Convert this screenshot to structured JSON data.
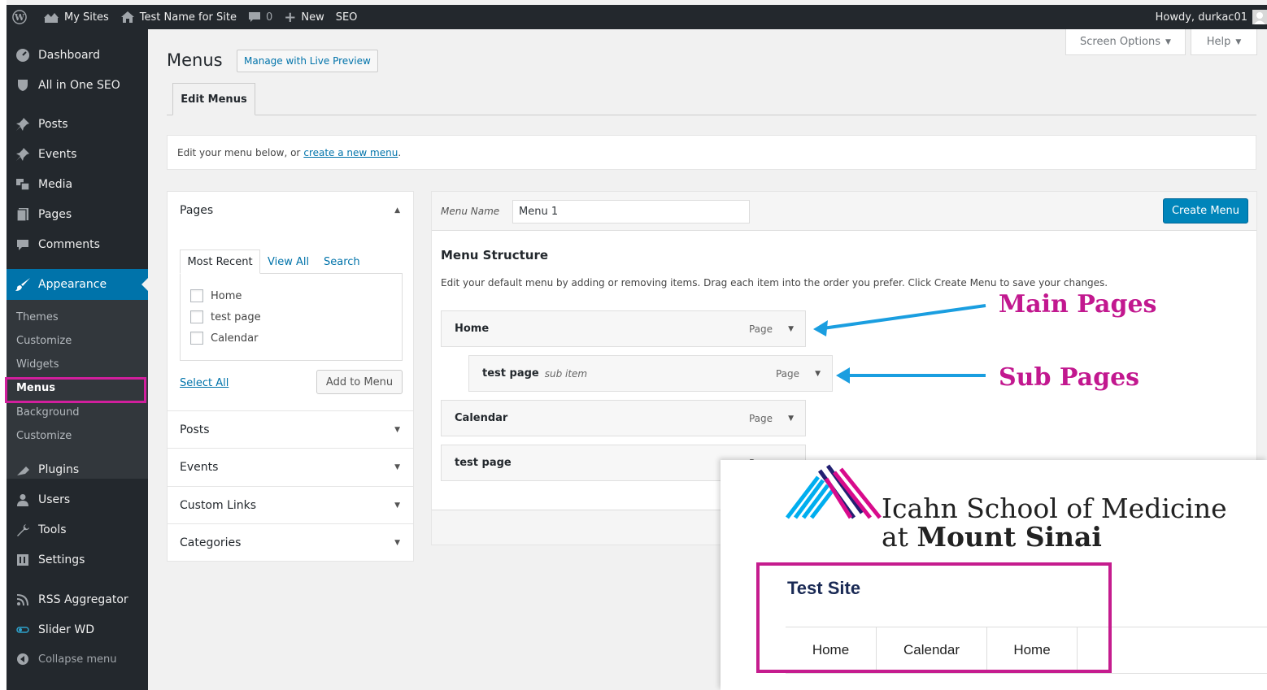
{
  "admin_bar": {
    "my_sites": "My Sites",
    "site_name": "Test Name for Site",
    "comments_count": "0",
    "new_label": "New",
    "seo_label": "SEO",
    "greeting": "Howdy, durkac01"
  },
  "sidebar": {
    "items": [
      {
        "label": "Dashboard",
        "icon": "dashboard-icon"
      },
      {
        "label": "All in One SEO",
        "icon": "shield-icon"
      },
      {
        "label": "Posts",
        "icon": "pin-icon"
      },
      {
        "label": "Events",
        "icon": "pin-icon"
      },
      {
        "label": "Media",
        "icon": "media-icon"
      },
      {
        "label": "Pages",
        "icon": "pages-icon"
      },
      {
        "label": "Comments",
        "icon": "comment-icon"
      },
      {
        "label": "Appearance",
        "icon": "paintbrush-icon"
      },
      {
        "label": "Plugins",
        "icon": "plug-icon"
      },
      {
        "label": "Users",
        "icon": "user-icon"
      },
      {
        "label": "Tools",
        "icon": "wrench-icon"
      },
      {
        "label": "Settings",
        "icon": "settings-icon"
      },
      {
        "label": "RSS Aggregator",
        "icon": "rss-icon"
      },
      {
        "label": "Slider WD",
        "icon": "slider-icon"
      },
      {
        "label": "Collapse menu",
        "icon": "collapse-icon"
      }
    ],
    "submenu": [
      "Themes",
      "Customize",
      "Widgets",
      "Menus",
      "Background",
      "Customize"
    ]
  },
  "header": {
    "title": "Menus",
    "live_preview": "Manage with Live Preview",
    "screen_options": "Screen Options",
    "help": "Help"
  },
  "tabs": {
    "edit_menus": "Edit Menus"
  },
  "notice": {
    "text": "Edit your menu below, or",
    "link": "create a new menu",
    "suffix": "."
  },
  "pages_panel": {
    "title": "Pages",
    "tabs": [
      "Most Recent",
      "View All",
      "Search"
    ],
    "items": [
      "Home",
      "test page",
      "Calendar"
    ],
    "select_all": "Select All",
    "add_button": "Add to Menu",
    "sections": [
      "Posts",
      "Events",
      "Custom Links",
      "Categories"
    ]
  },
  "menu_panel": {
    "name_label": "Menu Name",
    "name_value": "Menu 1",
    "create_button": "Create Menu",
    "structure_title": "Menu Structure",
    "structure_desc": "Edit your default menu by adding or removing items. Drag each item into the order you prefer. Click Create Menu to save your changes.",
    "items": [
      {
        "title": "Home",
        "note": "",
        "type": "Page"
      },
      {
        "title": "test page",
        "note": "sub item",
        "type": "Page"
      },
      {
        "title": "Calendar",
        "note": "",
        "type": "Page"
      },
      {
        "title": "test page",
        "note": "",
        "type": "Page"
      }
    ]
  },
  "annotations": {
    "main_pages": "Main Pages",
    "sub_pages": "Sub Pages"
  },
  "preview": {
    "logo_line1": "Icahn School of Medicine",
    "logo_line2_prefix": "at ",
    "logo_line2_bold": "Mount Sinai",
    "site_title": "Test Site",
    "nav": [
      "Home",
      "Calendar",
      "Home"
    ]
  },
  "colors": {
    "admin_dark": "#23282d",
    "wp_blue": "#0073aa",
    "button_blue": "#0085ba",
    "annotation_magenta": "#c2188f",
    "arrow_blue": "#1a9ee0"
  }
}
